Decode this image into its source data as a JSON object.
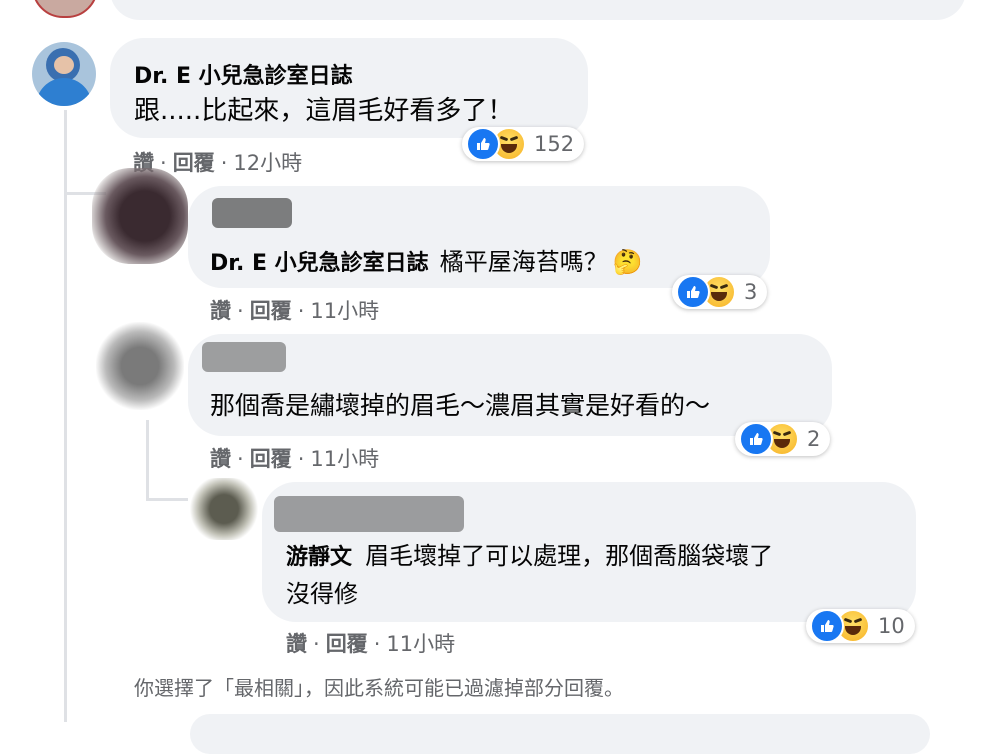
{
  "top_comment": {
    "author": "Dr. E 小兒急診室日誌",
    "text": "跟.....比起來，這眉毛好看多了！",
    "reaction_count": "152",
    "actions": {
      "like": "讚",
      "reply": "回覆",
      "time": "12小時"
    }
  },
  "replies": [
    {
      "mention": "Dr. E 小兒急診室日誌",
      "text": "橘平屋海苔嗎？",
      "emoji": "🤔",
      "reaction_count": "3",
      "actions": {
        "like": "讚",
        "reply": "回覆",
        "time": "11小時"
      }
    },
    {
      "text": "那個喬是繡壞掉的眉毛～濃眉其實是好看的～",
      "reaction_count": "2",
      "actions": {
        "like": "讚",
        "reply": "回覆",
        "time": "11小時"
      }
    },
    {
      "mention": "游靜文",
      "text_line1": "眉毛壞掉了可以處理，那個喬腦袋壞了",
      "text_line2": "沒得修",
      "reaction_count": "10",
      "actions": {
        "like": "讚",
        "reply": "回覆",
        "time": "11小時"
      }
    }
  ],
  "filter_notice": "你選擇了「最相關」，因此系統可能已過濾掉部分回覆。",
  "icons": [
    "like-icon",
    "haha-icon",
    "thinking-emoji"
  ],
  "colors": {
    "bubble": "#f0f2f5",
    "like": "#1877f2",
    "secondary_text": "#65676b"
  }
}
